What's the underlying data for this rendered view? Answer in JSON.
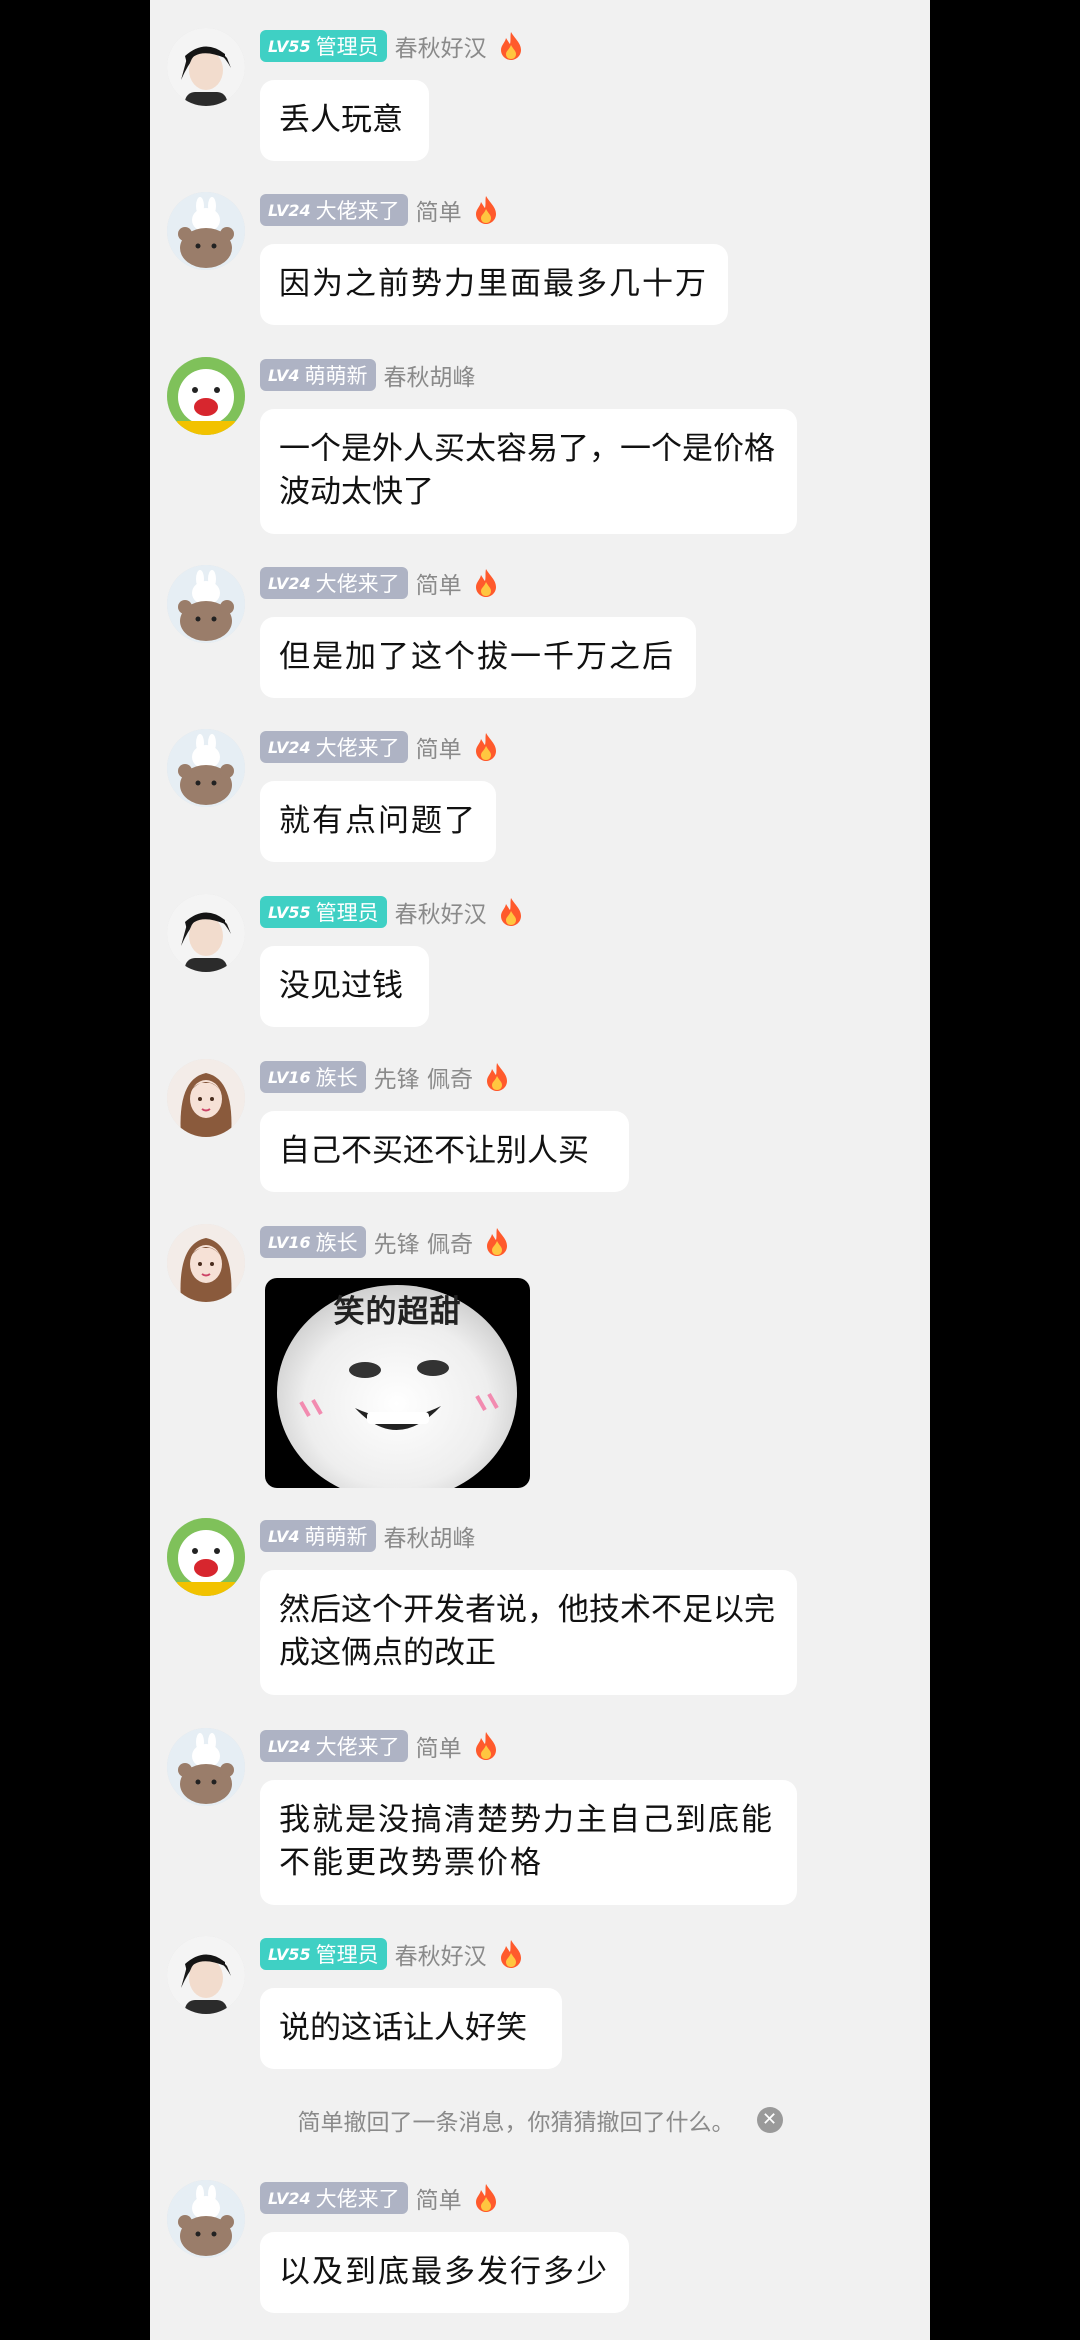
{
  "messages": [
    {
      "user": "春秋好汉",
      "level": "LV55",
      "title": "管理员",
      "badge": "teal",
      "avatar": "boy",
      "fire": true,
      "text": "丢人玩意",
      "style": "sans"
    },
    {
      "user": "简单",
      "level": "LV24",
      "title": "大佬来了",
      "badge": "grey",
      "avatar": "bear",
      "fire": true,
      "text": "因为之前势力里面最多几十万",
      "style": "serif"
    },
    {
      "user": "春秋胡峰",
      "level": "LV4",
      "title": "萌萌新",
      "badge": "grey",
      "avatar": "cartoon",
      "fire": false,
      "text": "一个是外人买太容易了，一个是价格波动太快了",
      "style": "sans"
    },
    {
      "user": "简单",
      "level": "LV24",
      "title": "大佬来了",
      "badge": "grey",
      "avatar": "bear",
      "fire": true,
      "text": "但是加了这个拔一千万之后",
      "style": "serif"
    },
    {
      "user": "简单",
      "level": "LV24",
      "title": "大佬来了",
      "badge": "grey",
      "avatar": "bear",
      "fire": true,
      "text": "就有点问题了",
      "style": "serif"
    },
    {
      "user": "春秋好汉",
      "level": "LV55",
      "title": "管理员",
      "badge": "teal",
      "avatar": "boy",
      "fire": true,
      "text": "没见过钱",
      "style": "sans"
    },
    {
      "user": "先锋 佩奇",
      "level": "LV16",
      "title": "族长",
      "badge": "grey",
      "avatar": "girl",
      "fire": true,
      "text": "自己不买还不让别人买",
      "style": "sans"
    },
    {
      "user": "先锋 佩奇",
      "level": "LV16",
      "title": "族长",
      "badge": "grey",
      "avatar": "girl",
      "fire": true,
      "sticker": "笑的超甜"
    },
    {
      "user": "春秋胡峰",
      "level": "LV4",
      "title": "萌萌新",
      "badge": "grey",
      "avatar": "cartoon",
      "fire": false,
      "text": "然后这个开发者说，他技术不足以完成这俩点的改正",
      "style": "sans"
    },
    {
      "user": "简单",
      "level": "LV24",
      "title": "大佬来了",
      "badge": "grey",
      "avatar": "bear",
      "fire": true,
      "text": "我就是没搞清楚势力主自己到底能不能更改势票价格",
      "style": "serif"
    },
    {
      "user": "春秋好汉",
      "level": "LV55",
      "title": "管理员",
      "badge": "teal",
      "avatar": "boy",
      "fire": true,
      "text": "说的这话让人好笑",
      "style": "sans"
    },
    {
      "user": "简单",
      "level": "LV24",
      "title": "大佬来了",
      "badge": "grey",
      "avatar": "bear",
      "fire": true,
      "text": "以及到底最多发行多少",
      "style": "serif"
    }
  ],
  "recall_notice": "简单撤回了一条消息，你猜猜撤回了什么。",
  "recall_close_glyph": "✕",
  "colors": {
    "teal_badge": "#3fd0c4",
    "grey_badge": "#aeb3c4",
    "bg": "#f1f1f1",
    "bubble": "#ffffff"
  }
}
